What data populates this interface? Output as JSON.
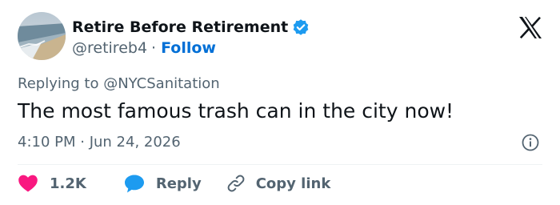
{
  "author": {
    "display_name": "Retire Before Retirement",
    "handle": "@retireb4",
    "separator": "·",
    "follow_label": "Follow",
    "verified": true
  },
  "tweet": {
    "replying_to_prefix": "Replying to ",
    "replying_to_handle": "@NYCSanitation",
    "text": "The most famous trash can in the city now!",
    "timestamp": "4:10 PM · Jun 24, 2026"
  },
  "actions": {
    "like_count": "1.2K",
    "reply_label": "Reply",
    "copy_link_label": "Copy link"
  },
  "icons": {
    "logo": "x-logo-icon",
    "verified": "verified-badge-icon",
    "info": "info-icon",
    "like": "heart-icon",
    "reply": "speech-bubble-icon",
    "copy": "link-icon"
  },
  "colors": {
    "text": "#0f1419",
    "muted": "#536471",
    "link": "#006fd6",
    "verified": "#1d9bf0",
    "heart": "#f91880",
    "bubble": "#1d9bf0",
    "divider": "#eff3f4"
  }
}
